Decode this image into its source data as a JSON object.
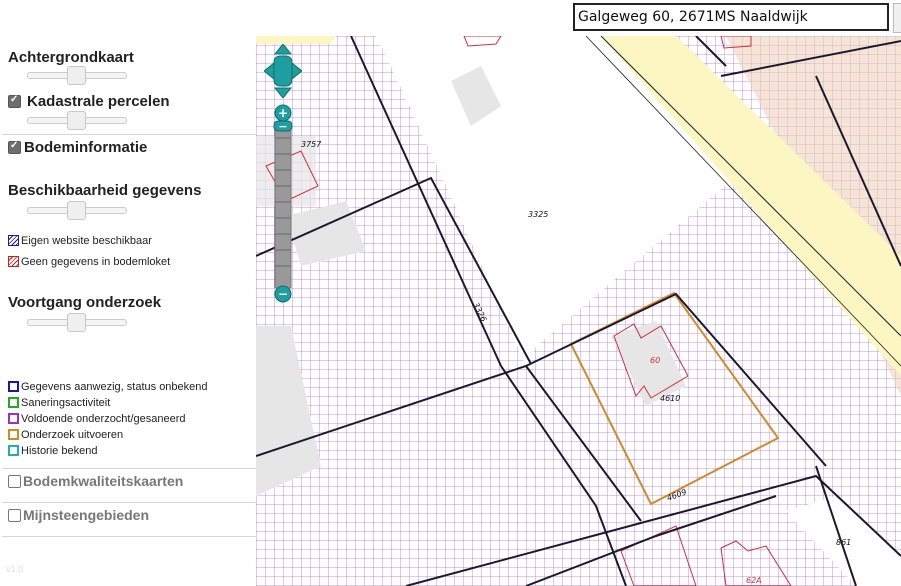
{
  "sidebar": {
    "achtergrondkaart": {
      "title": "Achtergrondkaart",
      "slider_value": 0.5
    },
    "kadastrale": {
      "title": "Kadastrale percelen",
      "checked": true,
      "slider_value": 0.5
    },
    "bodeminformatie": {
      "title": "Bodeminformatie",
      "checked": true
    },
    "beschikbaarheid": {
      "title": "Beschikbaarheid gegevens",
      "slider_value": 0.5,
      "legend": [
        {
          "label": "Eigen website beschikbaar",
          "color": "#1a1aa0"
        },
        {
          "label": "Geen gegevens in bodemloket",
          "color": "#cc2020"
        }
      ]
    },
    "voortgang": {
      "title": "Voortgang onderzoek",
      "slider_value": 0.5,
      "legend": [
        {
          "label": "Gegevens aanwezig, status onbekend",
          "color": "#1a1aa0"
        },
        {
          "label": "Saneringsactiviteit",
          "color": "#22aa22"
        },
        {
          "label": "Voldoende onderzocht/gesaneerd",
          "color": "#9b30c8"
        },
        {
          "label": "Onderzoek uitvoeren",
          "color": "#d08a2a"
        },
        {
          "label": "Historie bekend",
          "color": "#20b0b0"
        }
      ]
    },
    "bodemkwaliteitskaarten": {
      "title": "Bodemkwaliteitskaarten",
      "checked": false
    },
    "mijnsteengebieden": {
      "title": "Mijnsteengebieden",
      "checked": false
    },
    "version": "v1.0"
  },
  "search": {
    "value": "Galgeweg 60, 2671MS Naaldwijk"
  },
  "map": {
    "parcel_labels": [
      "3757",
      "3325",
      "3326",
      "60",
      "4610",
      "4609",
      "861",
      "62A"
    ],
    "colors": {
      "road": "#fbf6c2",
      "grid": "#b070d8",
      "parcel_line": "#1a1a2e",
      "building": "#e6e6e6",
      "building_outline": "#d0303a",
      "orange": "#d08a2a",
      "peach": "#f6e4d6"
    }
  }
}
